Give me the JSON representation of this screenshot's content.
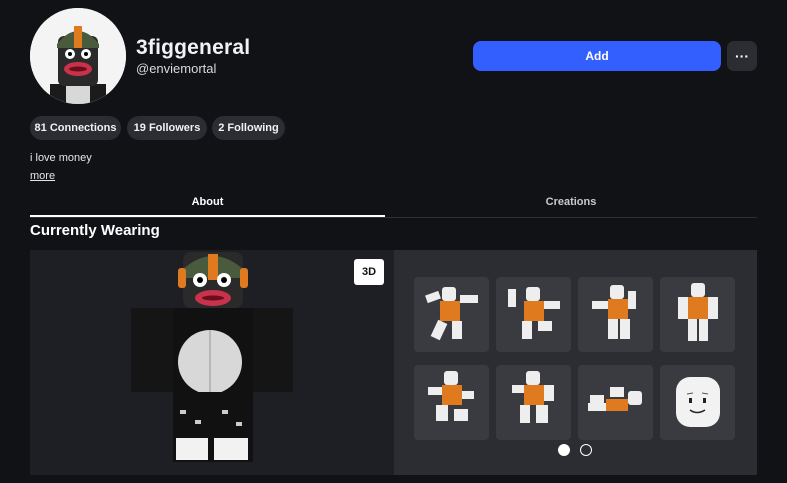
{
  "profile": {
    "display_name": "3figgeneral",
    "username": "@enviemortal",
    "bio": "i love money",
    "more_label": "more"
  },
  "actions": {
    "add_label": "Add",
    "more_label": "···"
  },
  "stats": [
    {
      "label": "81 Connections"
    },
    {
      "label": "19 Followers"
    },
    {
      "label": "2 Following"
    }
  ],
  "tabs": [
    {
      "label": "About",
      "active": true
    },
    {
      "label": "Creations",
      "active": false
    }
  ],
  "wearing": {
    "title": "Currently Wearing",
    "view_toggle_label": "3D",
    "page_indicator": {
      "current": 1,
      "total": 2
    }
  },
  "colors": {
    "accent": "#335fff",
    "background": "#111216",
    "panel": "#2b2d33"
  }
}
